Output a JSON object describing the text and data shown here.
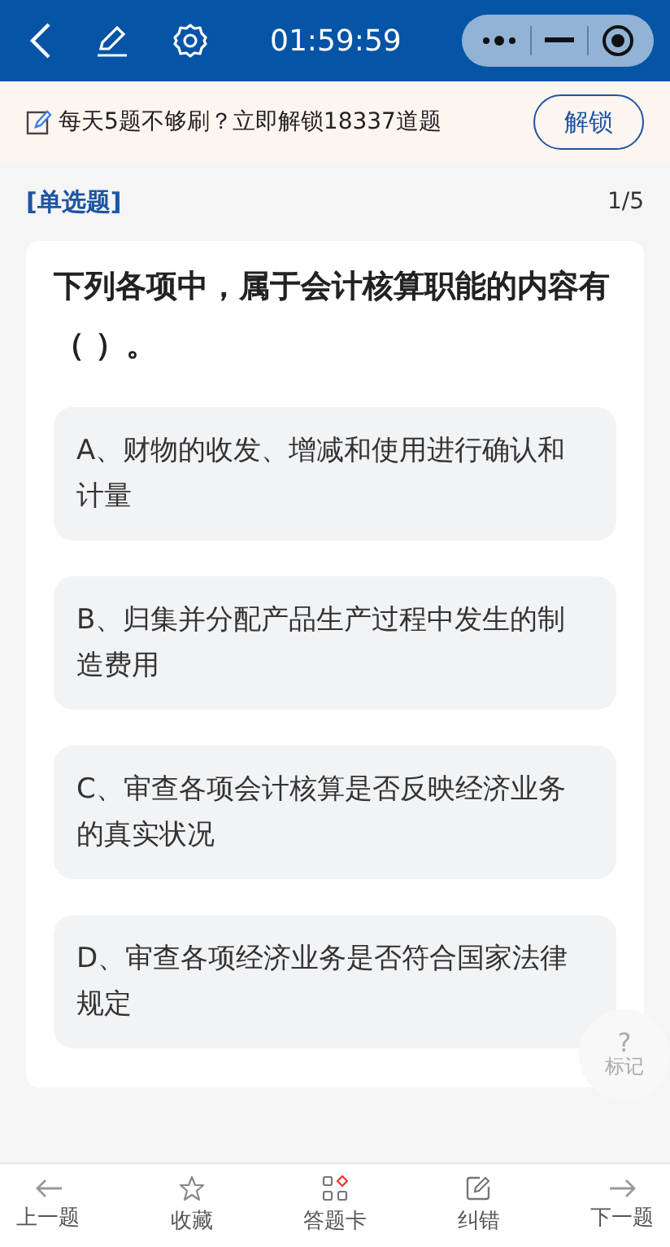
{
  "top_bar": {
    "timer": "01:59:59"
  },
  "banner": {
    "text": "每天5题不够刷？立即解锁18337道题",
    "button": "解锁"
  },
  "question": {
    "type": "[单选题]",
    "progress": "1/5",
    "stem": "下列各项中，属于会计核算职能的内容有（ ）。",
    "options": [
      {
        "text": "A、财物的收发、增减和使用进行确认和计量",
        "selected": false
      },
      {
        "text": "B、归集并分配产品生产过程中发生的制造费用",
        "selected": false
      },
      {
        "text": "C、审查各项会计核算是否反映经济业务的真实状况",
        "selected": false
      },
      {
        "text": "D、审查各项经济业务是否符合国家法律规定",
        "selected": false
      }
    ]
  },
  "mark_button": {
    "symbol": "?",
    "label": "标记"
  },
  "bottom_nav": [
    {
      "kind": "prev",
      "label": "上一题"
    },
    {
      "kind": "favorite",
      "label": "收藏"
    },
    {
      "kind": "card",
      "label": "答题卡"
    },
    {
      "kind": "error",
      "label": "纠错"
    },
    {
      "kind": "next",
      "label": "下一题"
    }
  ]
}
